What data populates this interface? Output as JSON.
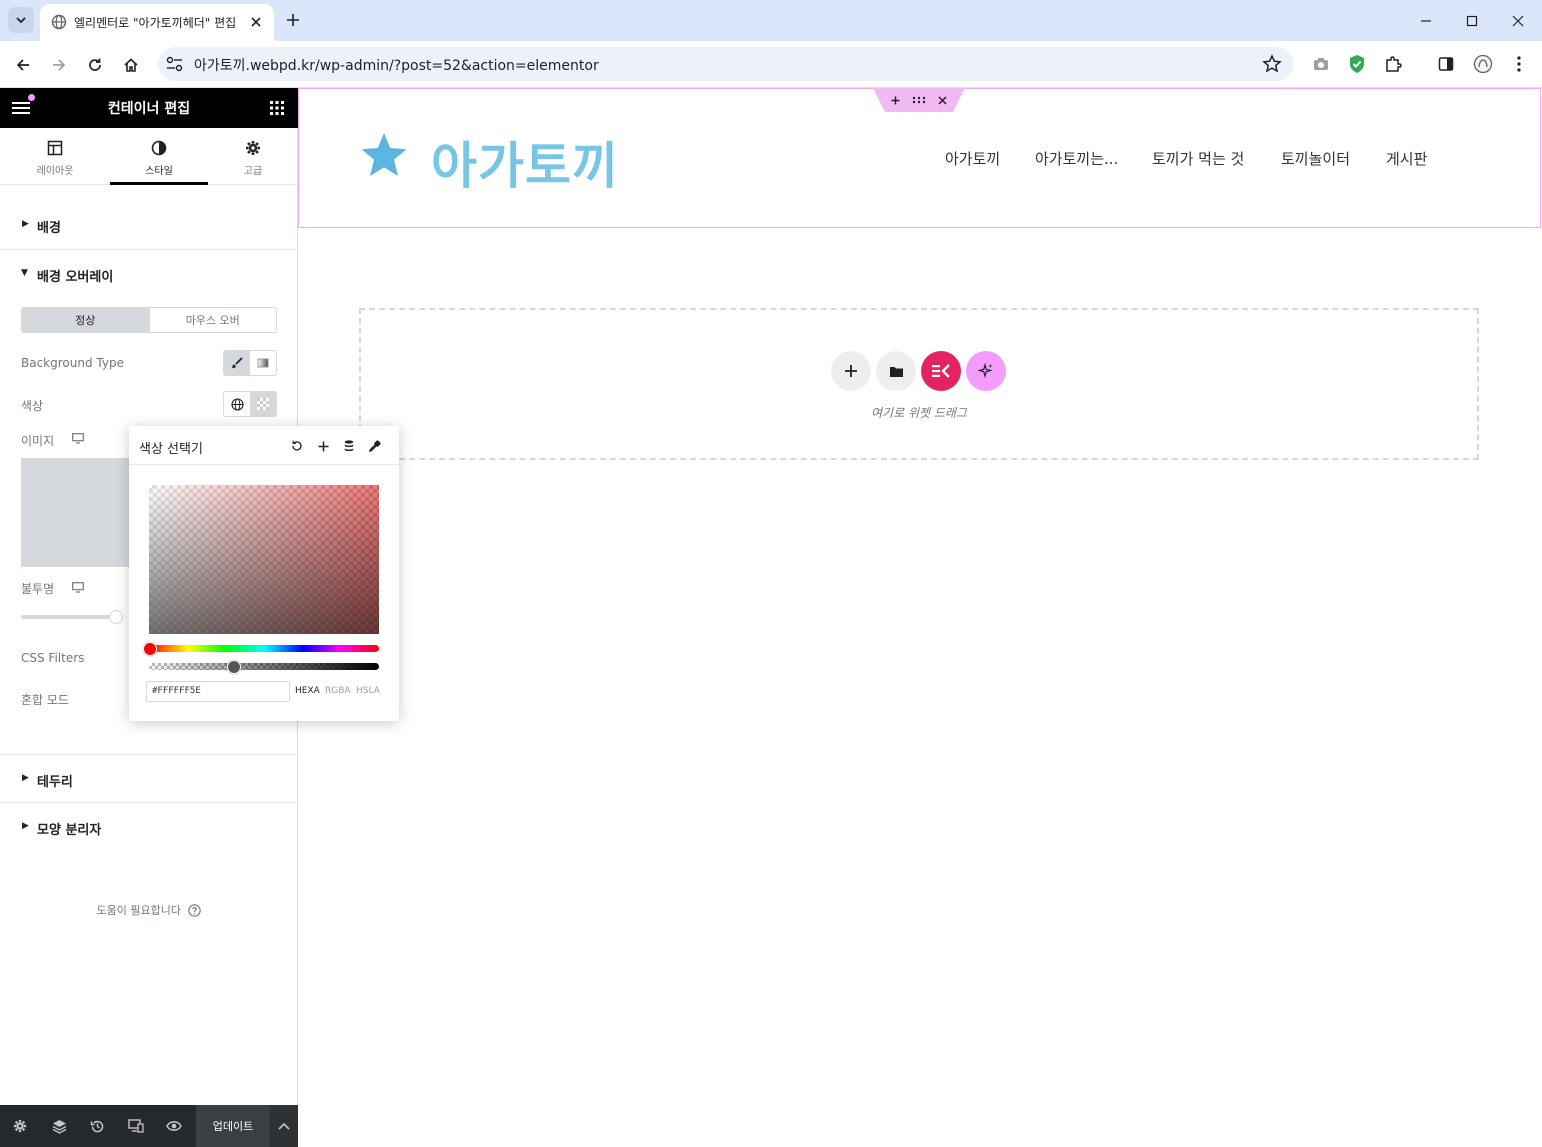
{
  "browser": {
    "tab_title": "엘리멘터로 \"아가토끼헤더\" 편집",
    "url": "아가토끼.webpd.kr/wp-admin/?post=52&action=elementor"
  },
  "panel": {
    "title": "컨테이너 편집",
    "tabs": [
      {
        "label": "레이아웃",
        "icon": "layout-icon"
      },
      {
        "label": "스타일",
        "icon": "contrast-icon"
      },
      {
        "label": "고급",
        "icon": "gear-icon"
      }
    ],
    "sections": {
      "background": "배경",
      "background_overlay": "배경 오버레이",
      "border": "테두리",
      "shape_divider": "모양 분리자"
    },
    "state_tabs": {
      "normal": "정상",
      "hover": "마우스 오버"
    },
    "controls": {
      "background_type": "Background Type",
      "color": "색상",
      "image": "이미지",
      "opacity": "불투명",
      "css_filters": "CSS Filters",
      "blend_mode": "혼합 모드"
    },
    "help": "도움이 필요합니다",
    "update_button": "업데이트"
  },
  "color_picker": {
    "title": "색상 선택기",
    "hex_value": "#FFFFFF5E",
    "formats": [
      "HEXA",
      "RGBA",
      "HSLA"
    ],
    "active_format": "HEXA",
    "alpha_level": 0.37
  },
  "canvas": {
    "logo_text": "아가토끼",
    "menu": [
      "아가토끼",
      "아가토끼는...",
      "토끼가 먹는 것",
      "토끼놀이터",
      "게시판"
    ],
    "drop_text": "여기로 위젯 드래그"
  },
  "colors": {
    "accent_pink": "#f1a8f3",
    "elementor_red": "#e2245f",
    "ai_pink": "#f39bff",
    "logo_blue": "#78c6e6"
  }
}
